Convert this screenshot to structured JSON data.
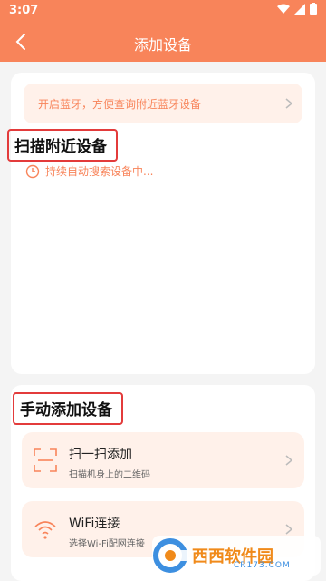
{
  "status": {
    "time": "3:07"
  },
  "appbar": {
    "title": "添加设备"
  },
  "bluetooth_banner": {
    "text": "开启蓝牙，方便查询附近蓝牙设备"
  },
  "nearby": {
    "title": "扫描附近设备",
    "status_text": "持续自动搜索设备中..."
  },
  "manual": {
    "title": "手动添加设备",
    "items": [
      {
        "label": "扫一扫添加",
        "sub": "扫描机身上的二维码",
        "icon": "scan-icon"
      },
      {
        "label": "WiFi连接",
        "sub": "选择Wi-Fi配网连接",
        "icon": "wifi-icon"
      }
    ]
  },
  "watermark": {
    "text": "西西软件园",
    "sub": "CR173.COM"
  },
  "colors": {
    "accent": "#f8845a",
    "banner_bg": "#fff1ea",
    "highlight_box": "#e33b3b"
  }
}
